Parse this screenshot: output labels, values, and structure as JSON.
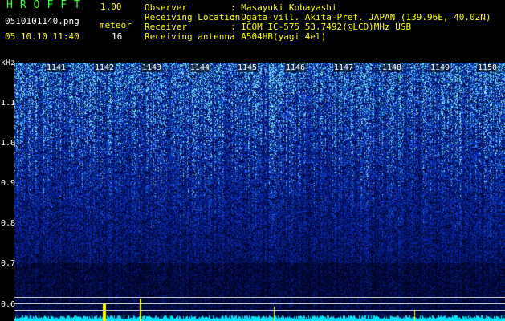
{
  "header": {
    "app_title": "HROFFT",
    "app_version": "1.00",
    "file_name": "0510101140.png",
    "mode_label": "meteor",
    "date_time": "05.10.10 11:40",
    "count_value": "16"
  },
  "info": [
    {
      "key": "Observer",
      "value": ": Masayuki Kobayashi"
    },
    {
      "key": "Receiving Location",
      "value": ": Ogata-vill. Akita-Pref. JAPAN (139.96E, 40.02N)"
    },
    {
      "key": "Receiver",
      "value": ": ICOM IC-575 53.7492(@LCD)MHz USB"
    },
    {
      "key": "Receiving antenna",
      "value": ": A504HB(yagi 4el)"
    }
  ],
  "axis": {
    "y_unit": "kHz",
    "y_labels": [
      "1.1",
      "1.0",
      "0.9",
      "0.8",
      "0.7",
      "0.6"
    ],
    "time_labels": [
      "1141",
      "1142",
      "1143",
      "1144",
      "1145",
      "1146",
      "1147",
      "1148",
      "1149",
      "1150"
    ]
  },
  "colors": {
    "spectrogram_background": "#0a1c7a",
    "title_green": "#33ff33",
    "version_yellow": "#ffff00",
    "signal_trace": "#00e5ff",
    "meteor_spike": "#ffff00"
  }
}
